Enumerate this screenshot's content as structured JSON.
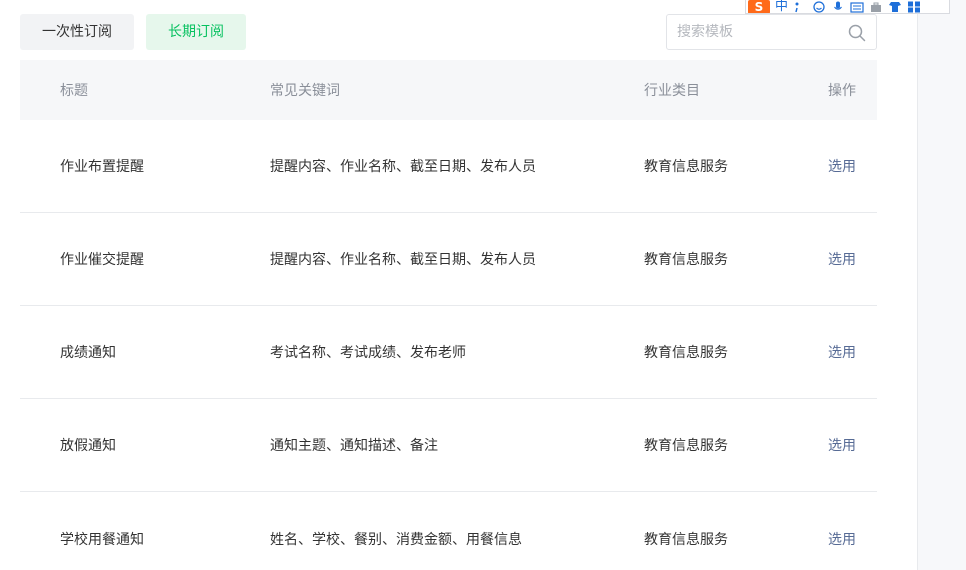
{
  "tabs": [
    {
      "label": "一次性订阅",
      "active": false
    },
    {
      "label": "长期订阅",
      "active": true
    }
  ],
  "search": {
    "placeholder": "搜索模板",
    "value": "",
    "icon": "search-icon"
  },
  "table": {
    "headers": {
      "title": "标题",
      "keywords": "常见关键词",
      "industry": "行业类目",
      "action": "操作"
    },
    "rows": [
      {
        "title": "作业布置提醒",
        "keywords": "提醒内容、作业名称、截至日期、发布人员",
        "industry": "教育信息服务",
        "action": "选用"
      },
      {
        "title": "作业催交提醒",
        "keywords": "提醒内容、作业名称、截至日期、发布人员",
        "industry": "教育信息服务",
        "action": "选用"
      },
      {
        "title": "成绩通知",
        "keywords": "考试名称、考试成绩、发布老师",
        "industry": "教育信息服务",
        "action": "选用"
      },
      {
        "title": "放假通知",
        "keywords": "通知主题、通知描述、备注",
        "industry": "教育信息服务",
        "action": "选用"
      },
      {
        "title": "学校用餐通知",
        "keywords": "姓名、学校、餐别、消费金额、用餐信息",
        "industry": "教育信息服务",
        "action": "选用"
      }
    ]
  },
  "ime_toolbar": {
    "logo": "S",
    "mode": "中",
    "icons": [
      "punctuation-icon",
      "emoji-icon",
      "microphone-icon",
      "keyboard-icon",
      "toolbox-icon",
      "skin-icon",
      "grid-menu-icon"
    ]
  },
  "colors": {
    "accent_green": "#07c160",
    "active_tab_bg": "#e6f7ec",
    "link": "#576b95",
    "header_bg": "#f6f7f9"
  }
}
